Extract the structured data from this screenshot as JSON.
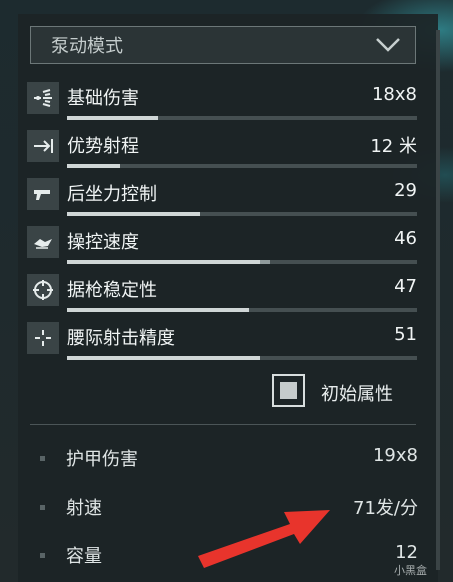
{
  "dropdown": {
    "label": "泵动模式"
  },
  "stats": [
    {
      "name": "基础伤害",
      "value": "18x8",
      "icon": "pellet-spread-icon",
      "fill": 0.26
    },
    {
      "name": "优势射程",
      "value": "12 米",
      "icon": "range-arrow-icon",
      "fill": 0.15
    },
    {
      "name": "后坐力控制",
      "value": "29",
      "icon": "pistol-recoil-icon",
      "fill": 0.38
    },
    {
      "name": "操控速度",
      "value": "46",
      "icon": "handling-icon",
      "fill": 0.55,
      "fill_secondary": 0.58
    },
    {
      "name": "据枪稳定性",
      "value": "47",
      "icon": "crosshair-circle-icon",
      "fill": 0.52
    },
    {
      "name": "腰际射击精度",
      "value": "51",
      "icon": "hipfire-crosshair-icon",
      "fill": 0.55
    }
  ],
  "checkbox": {
    "label": "初始属性",
    "checked": true
  },
  "details": [
    {
      "name": "护甲伤害",
      "value": "19x8"
    },
    {
      "name": "射速",
      "value": "71发/分"
    },
    {
      "name": "容量",
      "value": "12"
    }
  ],
  "watermark": {
    "text": "小黑盒"
  },
  "colors": {
    "arrow": "#e8342c",
    "bar_fill": "#cfd6d6",
    "accent_glow": "#3cbec8"
  }
}
